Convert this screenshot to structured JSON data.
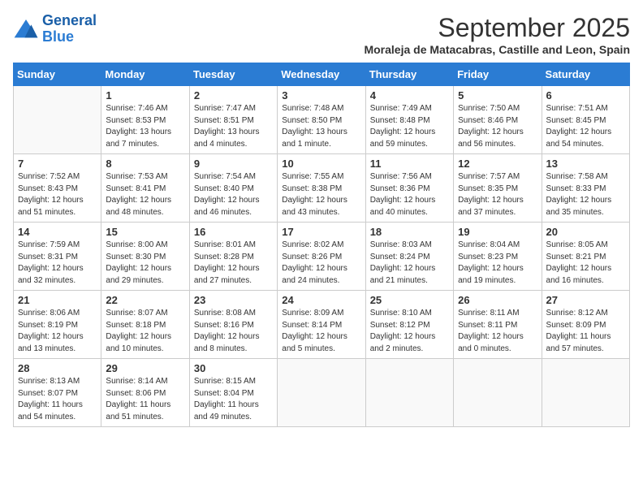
{
  "logo": {
    "line1": "General",
    "line2": "Blue"
  },
  "title": "September 2025",
  "subtitle": "Moraleja de Matacabras, Castille and Leon, Spain",
  "days_of_week": [
    "Sunday",
    "Monday",
    "Tuesday",
    "Wednesday",
    "Thursday",
    "Friday",
    "Saturday"
  ],
  "weeks": [
    [
      {
        "day": "",
        "info": ""
      },
      {
        "day": "1",
        "info": "Sunrise: 7:46 AM\nSunset: 8:53 PM\nDaylight: 13 hours\nand 7 minutes."
      },
      {
        "day": "2",
        "info": "Sunrise: 7:47 AM\nSunset: 8:51 PM\nDaylight: 13 hours\nand 4 minutes."
      },
      {
        "day": "3",
        "info": "Sunrise: 7:48 AM\nSunset: 8:50 PM\nDaylight: 13 hours\nand 1 minute."
      },
      {
        "day": "4",
        "info": "Sunrise: 7:49 AM\nSunset: 8:48 PM\nDaylight: 12 hours\nand 59 minutes."
      },
      {
        "day": "5",
        "info": "Sunrise: 7:50 AM\nSunset: 8:46 PM\nDaylight: 12 hours\nand 56 minutes."
      },
      {
        "day": "6",
        "info": "Sunrise: 7:51 AM\nSunset: 8:45 PM\nDaylight: 12 hours\nand 54 minutes."
      }
    ],
    [
      {
        "day": "7",
        "info": "Sunrise: 7:52 AM\nSunset: 8:43 PM\nDaylight: 12 hours\nand 51 minutes."
      },
      {
        "day": "8",
        "info": "Sunrise: 7:53 AM\nSunset: 8:41 PM\nDaylight: 12 hours\nand 48 minutes."
      },
      {
        "day": "9",
        "info": "Sunrise: 7:54 AM\nSunset: 8:40 PM\nDaylight: 12 hours\nand 46 minutes."
      },
      {
        "day": "10",
        "info": "Sunrise: 7:55 AM\nSunset: 8:38 PM\nDaylight: 12 hours\nand 43 minutes."
      },
      {
        "day": "11",
        "info": "Sunrise: 7:56 AM\nSunset: 8:36 PM\nDaylight: 12 hours\nand 40 minutes."
      },
      {
        "day": "12",
        "info": "Sunrise: 7:57 AM\nSunset: 8:35 PM\nDaylight: 12 hours\nand 37 minutes."
      },
      {
        "day": "13",
        "info": "Sunrise: 7:58 AM\nSunset: 8:33 PM\nDaylight: 12 hours\nand 35 minutes."
      }
    ],
    [
      {
        "day": "14",
        "info": "Sunrise: 7:59 AM\nSunset: 8:31 PM\nDaylight: 12 hours\nand 32 minutes."
      },
      {
        "day": "15",
        "info": "Sunrise: 8:00 AM\nSunset: 8:30 PM\nDaylight: 12 hours\nand 29 minutes."
      },
      {
        "day": "16",
        "info": "Sunrise: 8:01 AM\nSunset: 8:28 PM\nDaylight: 12 hours\nand 27 minutes."
      },
      {
        "day": "17",
        "info": "Sunrise: 8:02 AM\nSunset: 8:26 PM\nDaylight: 12 hours\nand 24 minutes."
      },
      {
        "day": "18",
        "info": "Sunrise: 8:03 AM\nSunset: 8:24 PM\nDaylight: 12 hours\nand 21 minutes."
      },
      {
        "day": "19",
        "info": "Sunrise: 8:04 AM\nSunset: 8:23 PM\nDaylight: 12 hours\nand 19 minutes."
      },
      {
        "day": "20",
        "info": "Sunrise: 8:05 AM\nSunset: 8:21 PM\nDaylight: 12 hours\nand 16 minutes."
      }
    ],
    [
      {
        "day": "21",
        "info": "Sunrise: 8:06 AM\nSunset: 8:19 PM\nDaylight: 12 hours\nand 13 minutes."
      },
      {
        "day": "22",
        "info": "Sunrise: 8:07 AM\nSunset: 8:18 PM\nDaylight: 12 hours\nand 10 minutes."
      },
      {
        "day": "23",
        "info": "Sunrise: 8:08 AM\nSunset: 8:16 PM\nDaylight: 12 hours\nand 8 minutes."
      },
      {
        "day": "24",
        "info": "Sunrise: 8:09 AM\nSunset: 8:14 PM\nDaylight: 12 hours\nand 5 minutes."
      },
      {
        "day": "25",
        "info": "Sunrise: 8:10 AM\nSunset: 8:12 PM\nDaylight: 12 hours\nand 2 minutes."
      },
      {
        "day": "26",
        "info": "Sunrise: 8:11 AM\nSunset: 8:11 PM\nDaylight: 12 hours\nand 0 minutes."
      },
      {
        "day": "27",
        "info": "Sunrise: 8:12 AM\nSunset: 8:09 PM\nDaylight: 11 hours\nand 57 minutes."
      }
    ],
    [
      {
        "day": "28",
        "info": "Sunrise: 8:13 AM\nSunset: 8:07 PM\nDaylight: 11 hours\nand 54 minutes."
      },
      {
        "day": "29",
        "info": "Sunrise: 8:14 AM\nSunset: 8:06 PM\nDaylight: 11 hours\nand 51 minutes."
      },
      {
        "day": "30",
        "info": "Sunrise: 8:15 AM\nSunset: 8:04 PM\nDaylight: 11 hours\nand 49 minutes."
      },
      {
        "day": "",
        "info": ""
      },
      {
        "day": "",
        "info": ""
      },
      {
        "day": "",
        "info": ""
      },
      {
        "day": "",
        "info": ""
      }
    ]
  ]
}
